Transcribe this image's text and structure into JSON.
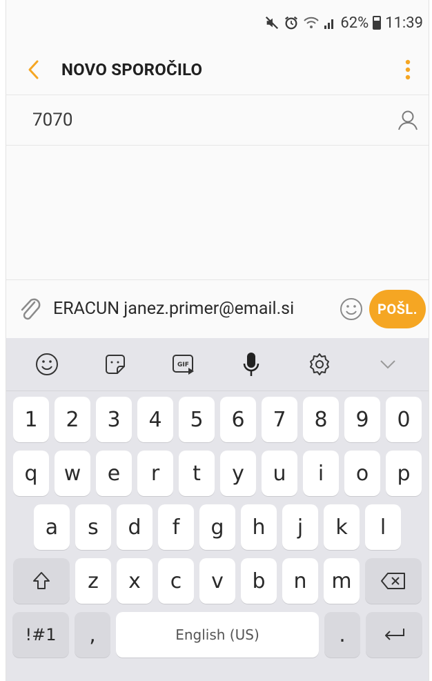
{
  "status": {
    "battery": "62%",
    "time": "11:39"
  },
  "header": {
    "title": "NOVO SPOROČILO"
  },
  "recipient": {
    "value": "7070"
  },
  "composer": {
    "message": "ERACUN janez.primer@email.si",
    "send_label": "POŠL."
  },
  "keyboard": {
    "numbers": [
      "1",
      "2",
      "3",
      "4",
      "5",
      "6",
      "7",
      "8",
      "9",
      "0"
    ],
    "row1": [
      "q",
      "w",
      "e",
      "r",
      "t",
      "y",
      "u",
      "i",
      "o",
      "p"
    ],
    "row2": [
      "a",
      "s",
      "d",
      "f",
      "g",
      "h",
      "j",
      "k",
      "l"
    ],
    "row3": [
      "z",
      "x",
      "c",
      "v",
      "b",
      "n",
      "m"
    ],
    "symbols_label": "!#1",
    "comma": ",",
    "space_label": "English (US)",
    "period": "."
  },
  "colors": {
    "accent": "#f5a623"
  }
}
